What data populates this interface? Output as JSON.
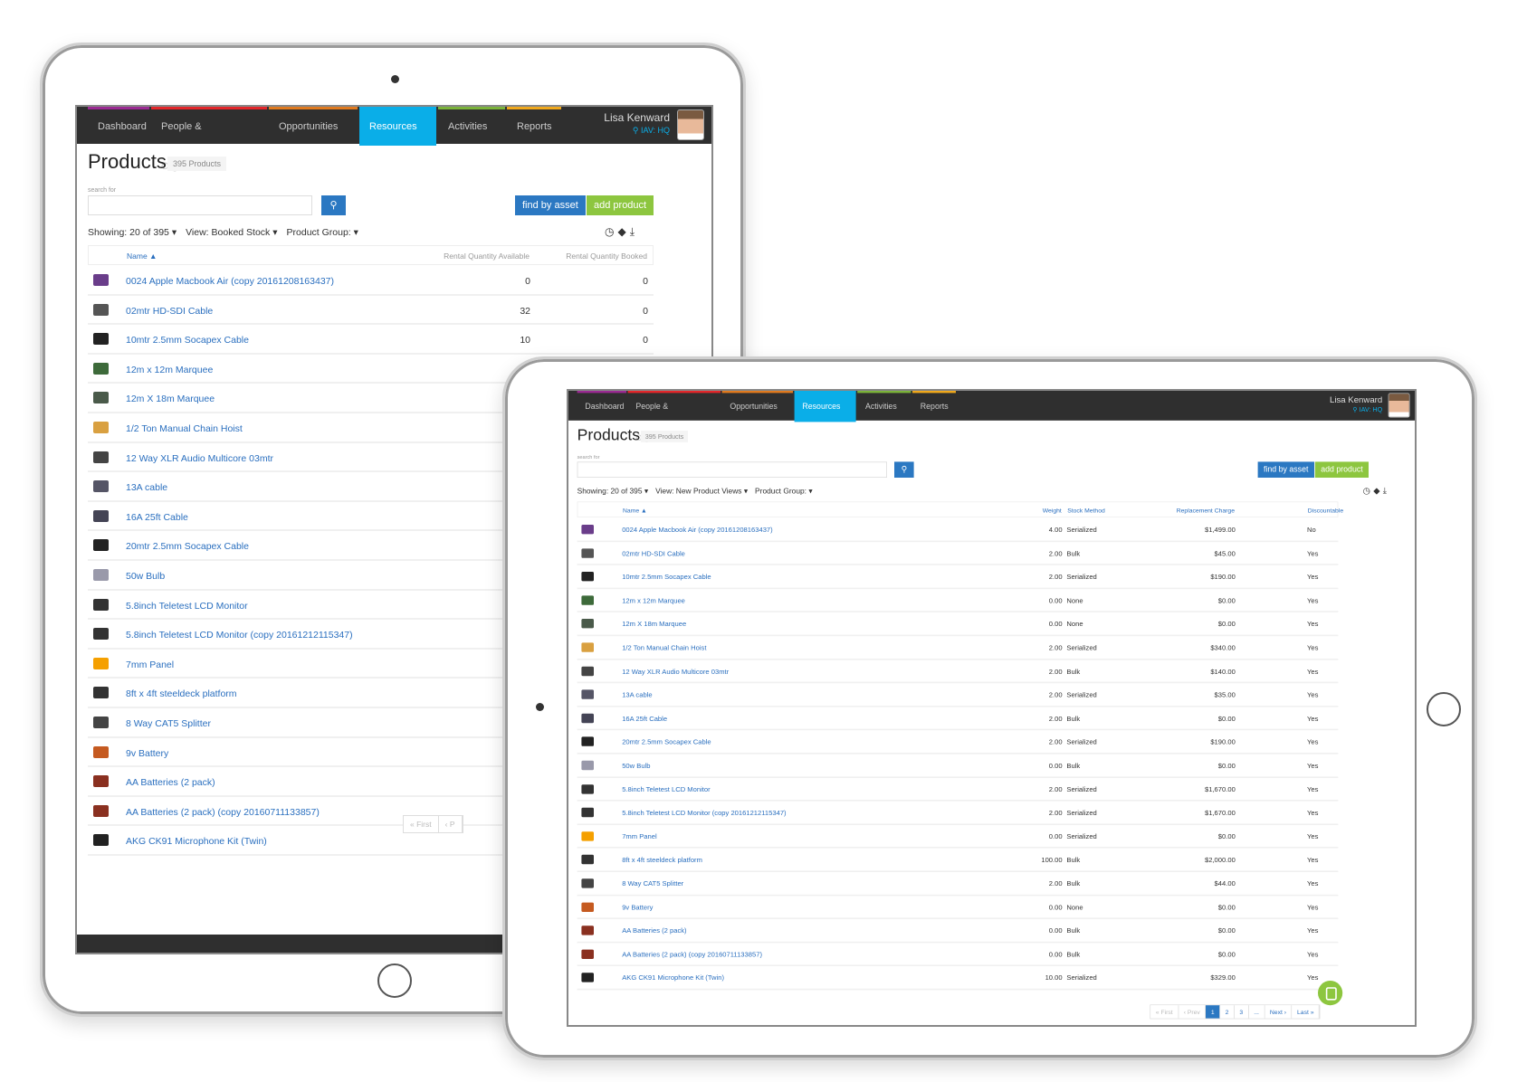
{
  "colors": {
    "nav_bg": "#2f2f2f",
    "active_tab": "#0aaee8",
    "link": "#2a6fbf",
    "primary_button": "#2b78c2",
    "success_button": "#8dc63f",
    "nav_strip": [
      "#9b2a93",
      "#e3262a",
      "#e07a1f",
      "#0aaee8",
      "#7bb33a",
      "#f0a81c"
    ]
  },
  "nav": {
    "items": [
      "Dashboard",
      "People & Organizations",
      "Opportunities",
      "Resources",
      "Activities",
      "Reports"
    ],
    "active": "Resources",
    "user_name": "Lisa Kenward",
    "location": "IAV: HQ"
  },
  "page": {
    "title": "Products",
    "count_badge": "395 Products",
    "search_label": "search for",
    "search_placeholder": "",
    "find_by_asset": "find by asset",
    "add_product": "add product",
    "showing": "Showing: 20 of 395",
    "product_group": "Product Group:",
    "icons": [
      "clock-icon",
      "tag-icon",
      "download-icon"
    ]
  },
  "back_tablet": {
    "view": "View: Booked Stock",
    "columns": [
      "Name ▲",
      "Rental Quantity Available",
      "Rental Quantity Booked"
    ],
    "rows": [
      {
        "name": "0024 Apple Macbook Air (copy 20161208163437)",
        "available": "0",
        "booked": "0"
      },
      {
        "name": "02mtr HD-SDI Cable",
        "available": "32",
        "booked": "0"
      },
      {
        "name": "10mtr 2.5mm Socapex Cable",
        "available": "10",
        "booked": "0"
      },
      {
        "name": "12m x 12m Marquee"
      },
      {
        "name": "12m X 18m Marquee"
      },
      {
        "name": "1/2 Ton Manual Chain Hoist"
      },
      {
        "name": "12 Way XLR Audio Multicore 03mtr"
      },
      {
        "name": "13A cable"
      },
      {
        "name": "16A 25ft Cable"
      },
      {
        "name": "20mtr 2.5mm Socapex Cable"
      },
      {
        "name": "50w Bulb"
      },
      {
        "name": "5.8inch Teletest LCD Monitor"
      },
      {
        "name": "5.8inch Teletest LCD Monitor (copy 20161212115347)"
      },
      {
        "name": "7mm Panel"
      },
      {
        "name": "8ft x 4ft steeldeck platform"
      },
      {
        "name": "8 Way CAT5 Splitter"
      },
      {
        "name": "9v Battery"
      },
      {
        "name": "AA Batteries (2 pack)"
      },
      {
        "name": "AA Batteries (2 pack) (copy 20160711133857)"
      },
      {
        "name": "AKG CK91 Microphone Kit (Twin)"
      }
    ],
    "pagination": [
      "« First",
      "‹ P"
    ]
  },
  "front_tablet": {
    "view": "View: New Product Views",
    "columns": [
      "Name ▲",
      "Weight",
      "Stock Method",
      "Replacement Charge",
      "Discountable"
    ],
    "rows": [
      {
        "name": "0024 Apple Macbook Air (copy 20161208163437)",
        "weight": "4.00",
        "stock": "Serialized",
        "charge": "$1,499.00",
        "disc": "No"
      },
      {
        "name": "02mtr HD-SDI Cable",
        "weight": "2.00",
        "stock": "Bulk",
        "charge": "$45.00",
        "disc": "Yes"
      },
      {
        "name": "10mtr 2.5mm Socapex Cable",
        "weight": "2.00",
        "stock": "Serialized",
        "charge": "$190.00",
        "disc": "Yes"
      },
      {
        "name": "12m x 12m Marquee",
        "weight": "0.00",
        "stock": "None",
        "charge": "$0.00",
        "disc": "Yes"
      },
      {
        "name": "12m X 18m Marquee",
        "weight": "0.00",
        "stock": "None",
        "charge": "$0.00",
        "disc": "Yes"
      },
      {
        "name": "1/2 Ton Manual Chain Hoist",
        "weight": "2.00",
        "stock": "Serialized",
        "charge": "$340.00",
        "disc": "Yes"
      },
      {
        "name": "12 Way XLR Audio Multicore 03mtr",
        "weight": "2.00",
        "stock": "Bulk",
        "charge": "$140.00",
        "disc": "Yes"
      },
      {
        "name": "13A cable",
        "weight": "2.00",
        "stock": "Serialized",
        "charge": "$35.00",
        "disc": "Yes"
      },
      {
        "name": "16A 25ft Cable",
        "weight": "2.00",
        "stock": "Bulk",
        "charge": "$0.00",
        "disc": "Yes"
      },
      {
        "name": "20mtr 2.5mm Socapex Cable",
        "weight": "2.00",
        "stock": "Serialized",
        "charge": "$190.00",
        "disc": "Yes"
      },
      {
        "name": "50w Bulb",
        "weight": "0.00",
        "stock": "Bulk",
        "charge": "$0.00",
        "disc": "Yes"
      },
      {
        "name": "5.8inch Teletest LCD Monitor",
        "weight": "2.00",
        "stock": "Serialized",
        "charge": "$1,670.00",
        "disc": "Yes"
      },
      {
        "name": "5.8inch Teletest LCD Monitor (copy 20161212115347)",
        "weight": "2.00",
        "stock": "Serialized",
        "charge": "$1,670.00",
        "disc": "Yes"
      },
      {
        "name": "7mm Panel",
        "weight": "0.00",
        "stock": "Serialized",
        "charge": "$0.00",
        "disc": "Yes"
      },
      {
        "name": "8ft x 4ft steeldeck platform",
        "weight": "100.00",
        "stock": "Bulk",
        "charge": "$2,000.00",
        "disc": "Yes"
      },
      {
        "name": "8 Way CAT5 Splitter",
        "weight": "2.00",
        "stock": "Bulk",
        "charge": "$44.00",
        "disc": "Yes"
      },
      {
        "name": "9v Battery",
        "weight": "0.00",
        "stock": "None",
        "charge": "$0.00",
        "disc": "Yes"
      },
      {
        "name": "AA Batteries (2 pack)",
        "weight": "0.00",
        "stock": "Bulk",
        "charge": "$0.00",
        "disc": "Yes"
      },
      {
        "name": "AA Batteries (2 pack) (copy 20160711133857)",
        "weight": "0.00",
        "stock": "Bulk",
        "charge": "$0.00",
        "disc": "Yes"
      },
      {
        "name": "AKG CK91 Microphone Kit (Twin)",
        "weight": "10.00",
        "stock": "Serialized",
        "charge": "$329.00",
        "disc": "Yes"
      }
    ],
    "pagination": [
      "« First",
      "‹ Prev",
      "1",
      "2",
      "3",
      "...",
      "Next ›",
      "Last »"
    ],
    "current_page": "1"
  }
}
